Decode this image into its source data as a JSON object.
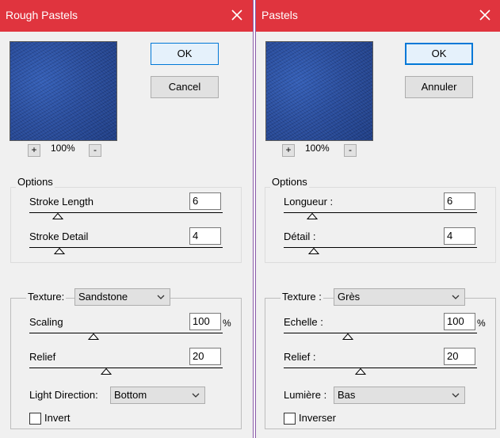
{
  "left": {
    "title": "Rough Pastels",
    "ok_label": "OK",
    "cancel_label": "Cancel",
    "zoom_in": "+",
    "zoom_out": "-",
    "zoom": "100%",
    "options_label": "Options",
    "stroke_length_label": "Stroke Length",
    "stroke_length_value": "6",
    "stroke_detail_label": "Stroke Detail",
    "stroke_detail_value": "4",
    "texture_label": "Texture:",
    "texture_value": "Sandstone",
    "scaling_label": "Scaling",
    "scaling_value": "100",
    "percent": "%",
    "relief_label": "Relief",
    "relief_value": "20",
    "light_label": "Light Direction:",
    "light_value": "Bottom",
    "invert_label": "Invert"
  },
  "right": {
    "title": "Pastels",
    "ok_label": "OK",
    "cancel_label": "Annuler",
    "zoom_in": "+",
    "zoom_out": "-",
    "zoom": "100%",
    "options_label": "Options",
    "stroke_length_label": "Longueur :",
    "stroke_length_value": "6",
    "stroke_detail_label": "Détail :",
    "stroke_detail_value": "4",
    "texture_label": "Texture :",
    "texture_value": "Grès",
    "scaling_label": "Echelle :",
    "scaling_value": "100",
    "percent": "%",
    "relief_label": "Relief :",
    "relief_value": "20",
    "light_label": "Lumière :",
    "light_value": "Bas",
    "invert_label": "Inverser"
  },
  "colors": {
    "titlebar": "#e0343e",
    "preview": "#2a4e9e",
    "ok_border": "#0078d7"
  }
}
